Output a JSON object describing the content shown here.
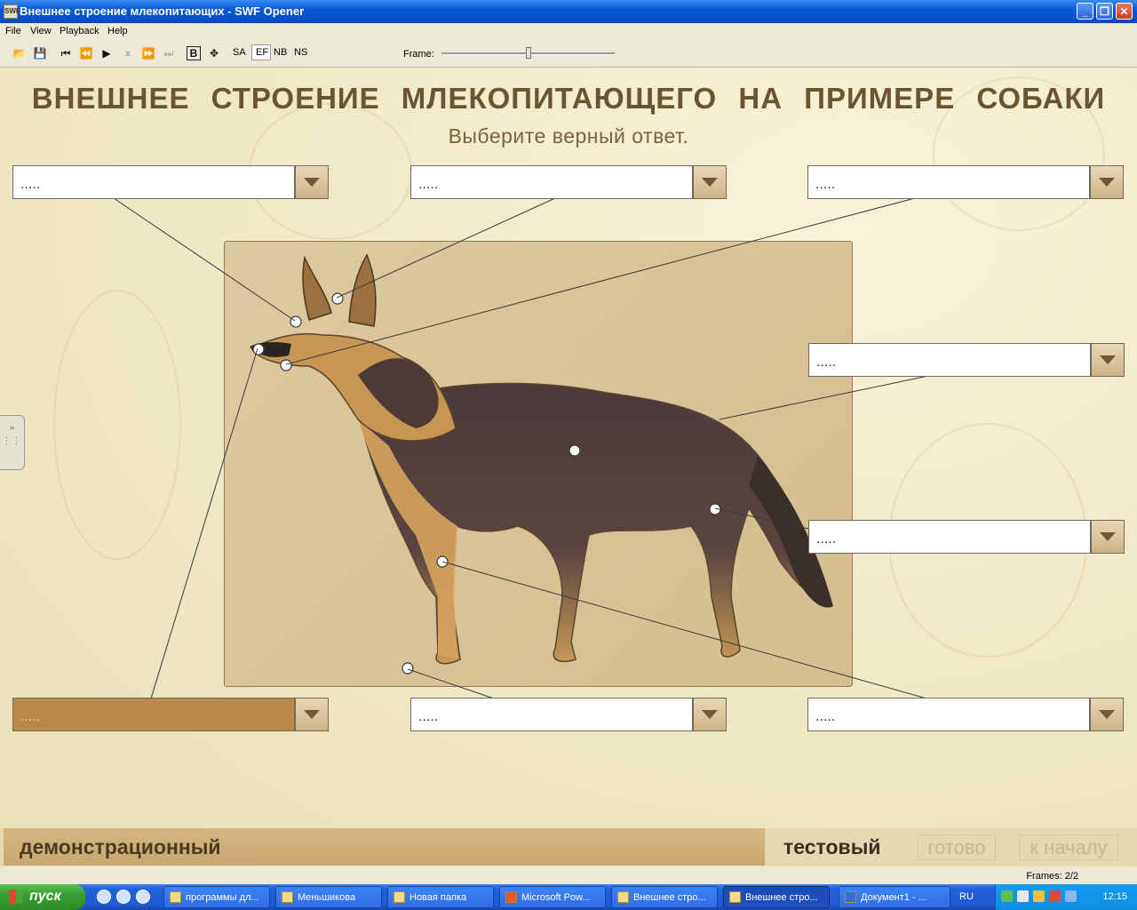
{
  "window": {
    "title": "Внешнее строение млекопитающих - SWF Opener",
    "icon_name": "swf-icon"
  },
  "menu": [
    "File",
    "View",
    "Playback",
    "Help"
  ],
  "toolbar": {
    "text_buttons": [
      "B",
      "SA",
      "EF",
      "NB",
      "NS"
    ],
    "frame_label": "Frame:",
    "frame_slider_fraction": 0.5
  },
  "content": {
    "title": "ВНЕШНЕЕ СТРОЕНИЕ МЛЕКОПИТАЮЩЕГО НА ПРИМЕРЕ СОБАКИ",
    "subtitle": "Выберите верный ответ.",
    "dropdown_placeholder": ".....",
    "dropdowns": [
      ".....",
      ".....",
      ".....",
      ".....",
      ".....",
      ".....",
      ".....",
      "....."
    ],
    "modes": {
      "demo": "демонстрационный",
      "test": "тестовый",
      "done": "готово",
      "to_start": "к началу"
    }
  },
  "status": {
    "frames": "Frames: 2/2"
  },
  "taskbar": {
    "start": "пуск",
    "tasks": [
      "программы дл...",
      "Меньшикова",
      "Новая папка",
      "Microsoft Pow...",
      "Внешнее стро...",
      "Внешнее стро...",
      "Документ1 - ..."
    ],
    "language": "RU",
    "clock": "12:15"
  },
  "colors": {
    "title_text": "#6a5530",
    "active_dropdown": "#b9894a",
    "taskbar": "#2360d8",
    "start_button": "#38a030"
  }
}
